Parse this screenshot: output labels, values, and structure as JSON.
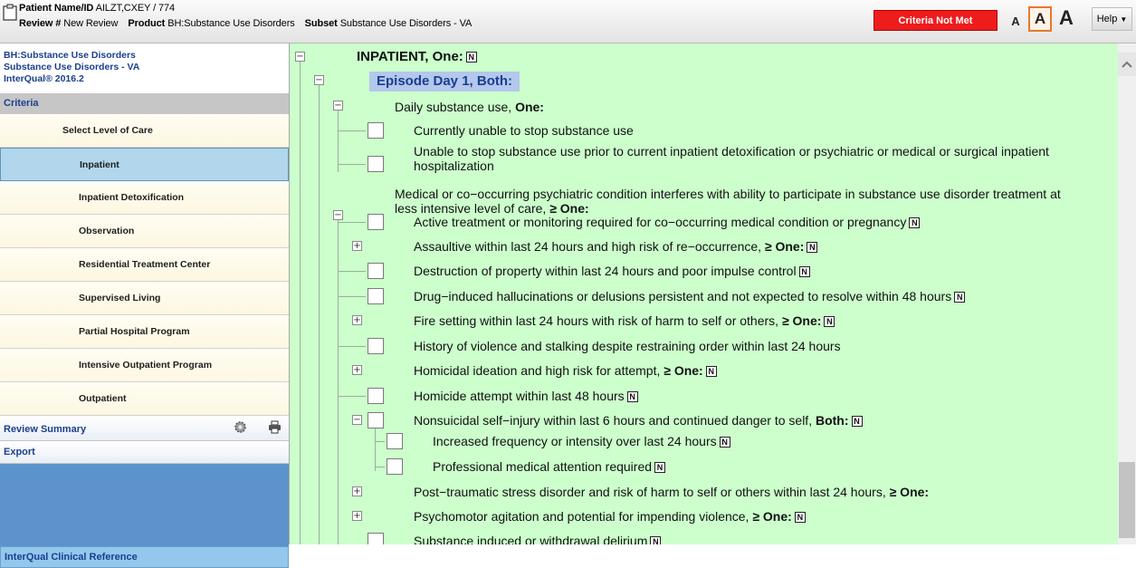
{
  "header": {
    "patient_label": "Patient Name/ID",
    "patient_value": "AILZT,CXEY / 774",
    "review_label": "Review #",
    "review_value": "New Review",
    "product_label": "Product",
    "product_value": "BH:Substance Use Disorders",
    "subset_label": "Subset",
    "subset_value": "Substance Use Disorders - VA",
    "criteria_status": "Criteria Not Met",
    "font_small": "A",
    "font_medium": "A",
    "font_large": "A",
    "help_label": "Help",
    "status_color": "#ee1c1c"
  },
  "sidebar": {
    "product_line1": "BH:Substance Use Disorders",
    "product_line2": "Substance Use Disorders - VA",
    "product_line3": "InterQual® 2016.2",
    "criteria_label": "Criteria",
    "select_level_label": "Select Level of Care",
    "levels": [
      "Inpatient",
      "Inpatient Detoxification",
      "Observation",
      "Residential Treatment Center",
      "Supervised Living",
      "Partial Hospital Program",
      "Intensive Outpatient Program",
      "Outpatient"
    ],
    "active_level": "Inpatient",
    "review_summary_label": "Review Summary",
    "export_label": "Export",
    "clinical_reference_label": "InterQual Clinical Reference",
    "accent_color": "#1a3f8f"
  },
  "tree": {
    "root_label": "INPATIENT",
    "root_op": ", One:",
    "episode_label": "Episode Day 1, Both:",
    "daily_label": "Daily substance use, ",
    "daily_op": "One:",
    "item_unable_now": "Currently unable to stop substance use",
    "item_unable_prior_1": "Unable to stop substance use prior to current inpatient detoxification or psychiatric or medical or surgical inpatient",
    "item_unable_prior_2": "hospitalization",
    "medical_label_1": "Medical or co−occurring psychiatric condition interferes with ability to participate in substance use disorder treatment at",
    "medical_label_2": "less intensive level of care, ",
    "medical_op": "≥ One:",
    "items": [
      "Active treatment or monitoring required for co−occurring medical condition or pregnancy",
      "Assaultive within last 24 hours and high risk of re−occurrence, ",
      "Destruction of property within last 24 hours and poor impulse control",
      "Drug−induced hallucinations or delusions persistent and not expected to resolve within 48 hours",
      "Fire setting within last 24 hours with risk of harm to self or others, ",
      "History of violence and stalking despite restraining order within last 24 hours",
      "Homicidal ideation and high risk for attempt, ",
      "Homicide attempt within last 48 hours",
      "Nonsuicidal self−injury within last 6 hours and continued danger to self, ",
      "Increased frequency or intensity over last 24 hours",
      "Professional medical attention required",
      "Post−traumatic stress disorder and risk of harm to self or others within last 24 hours, ",
      "Psychomotor agitation and potential for impending violence, ",
      "Substance induced or withdrawal delirium"
    ],
    "op_ge_one": "≥ One:",
    "op_both": "Both:",
    "note_icon": "N",
    "background_color": "#ccffcc"
  }
}
